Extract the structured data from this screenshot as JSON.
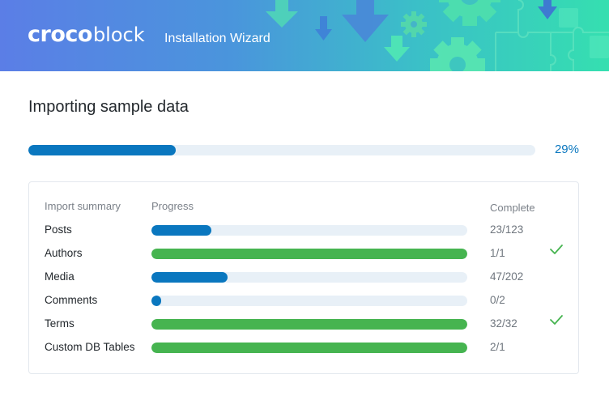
{
  "header": {
    "logo_bold": "croco",
    "logo_light": "block",
    "subtitle": "Installation Wizard"
  },
  "page": {
    "title": "Importing sample data"
  },
  "overall": {
    "progress_fraction": 0.29,
    "progress_label": "29%"
  },
  "summary": {
    "columns": {
      "name": "Import summary",
      "progress": "Progress",
      "complete": "Complete"
    },
    "rows": [
      {
        "label": "Posts",
        "count": "23/123",
        "progress_fraction": 0.19,
        "complete": false
      },
      {
        "label": "Authors",
        "count": "1/1",
        "progress_fraction": 1.0,
        "complete": true
      },
      {
        "label": "Media",
        "count": "47/202",
        "progress_fraction": 0.24,
        "complete": false
      },
      {
        "label": "Comments",
        "count": "0/2",
        "progress_fraction": 0.03,
        "complete": false
      },
      {
        "label": "Terms",
        "count": "32/32",
        "progress_fraction": 1.0,
        "complete": true
      },
      {
        "label": "Custom DB Tables",
        "count": "2/1",
        "progress_fraction": 1.0,
        "complete": false
      }
    ]
  },
  "colors": {
    "in_progress": "#0a77bf",
    "complete": "#46b450",
    "check": "#46b450",
    "track": "#e8f0f7"
  }
}
